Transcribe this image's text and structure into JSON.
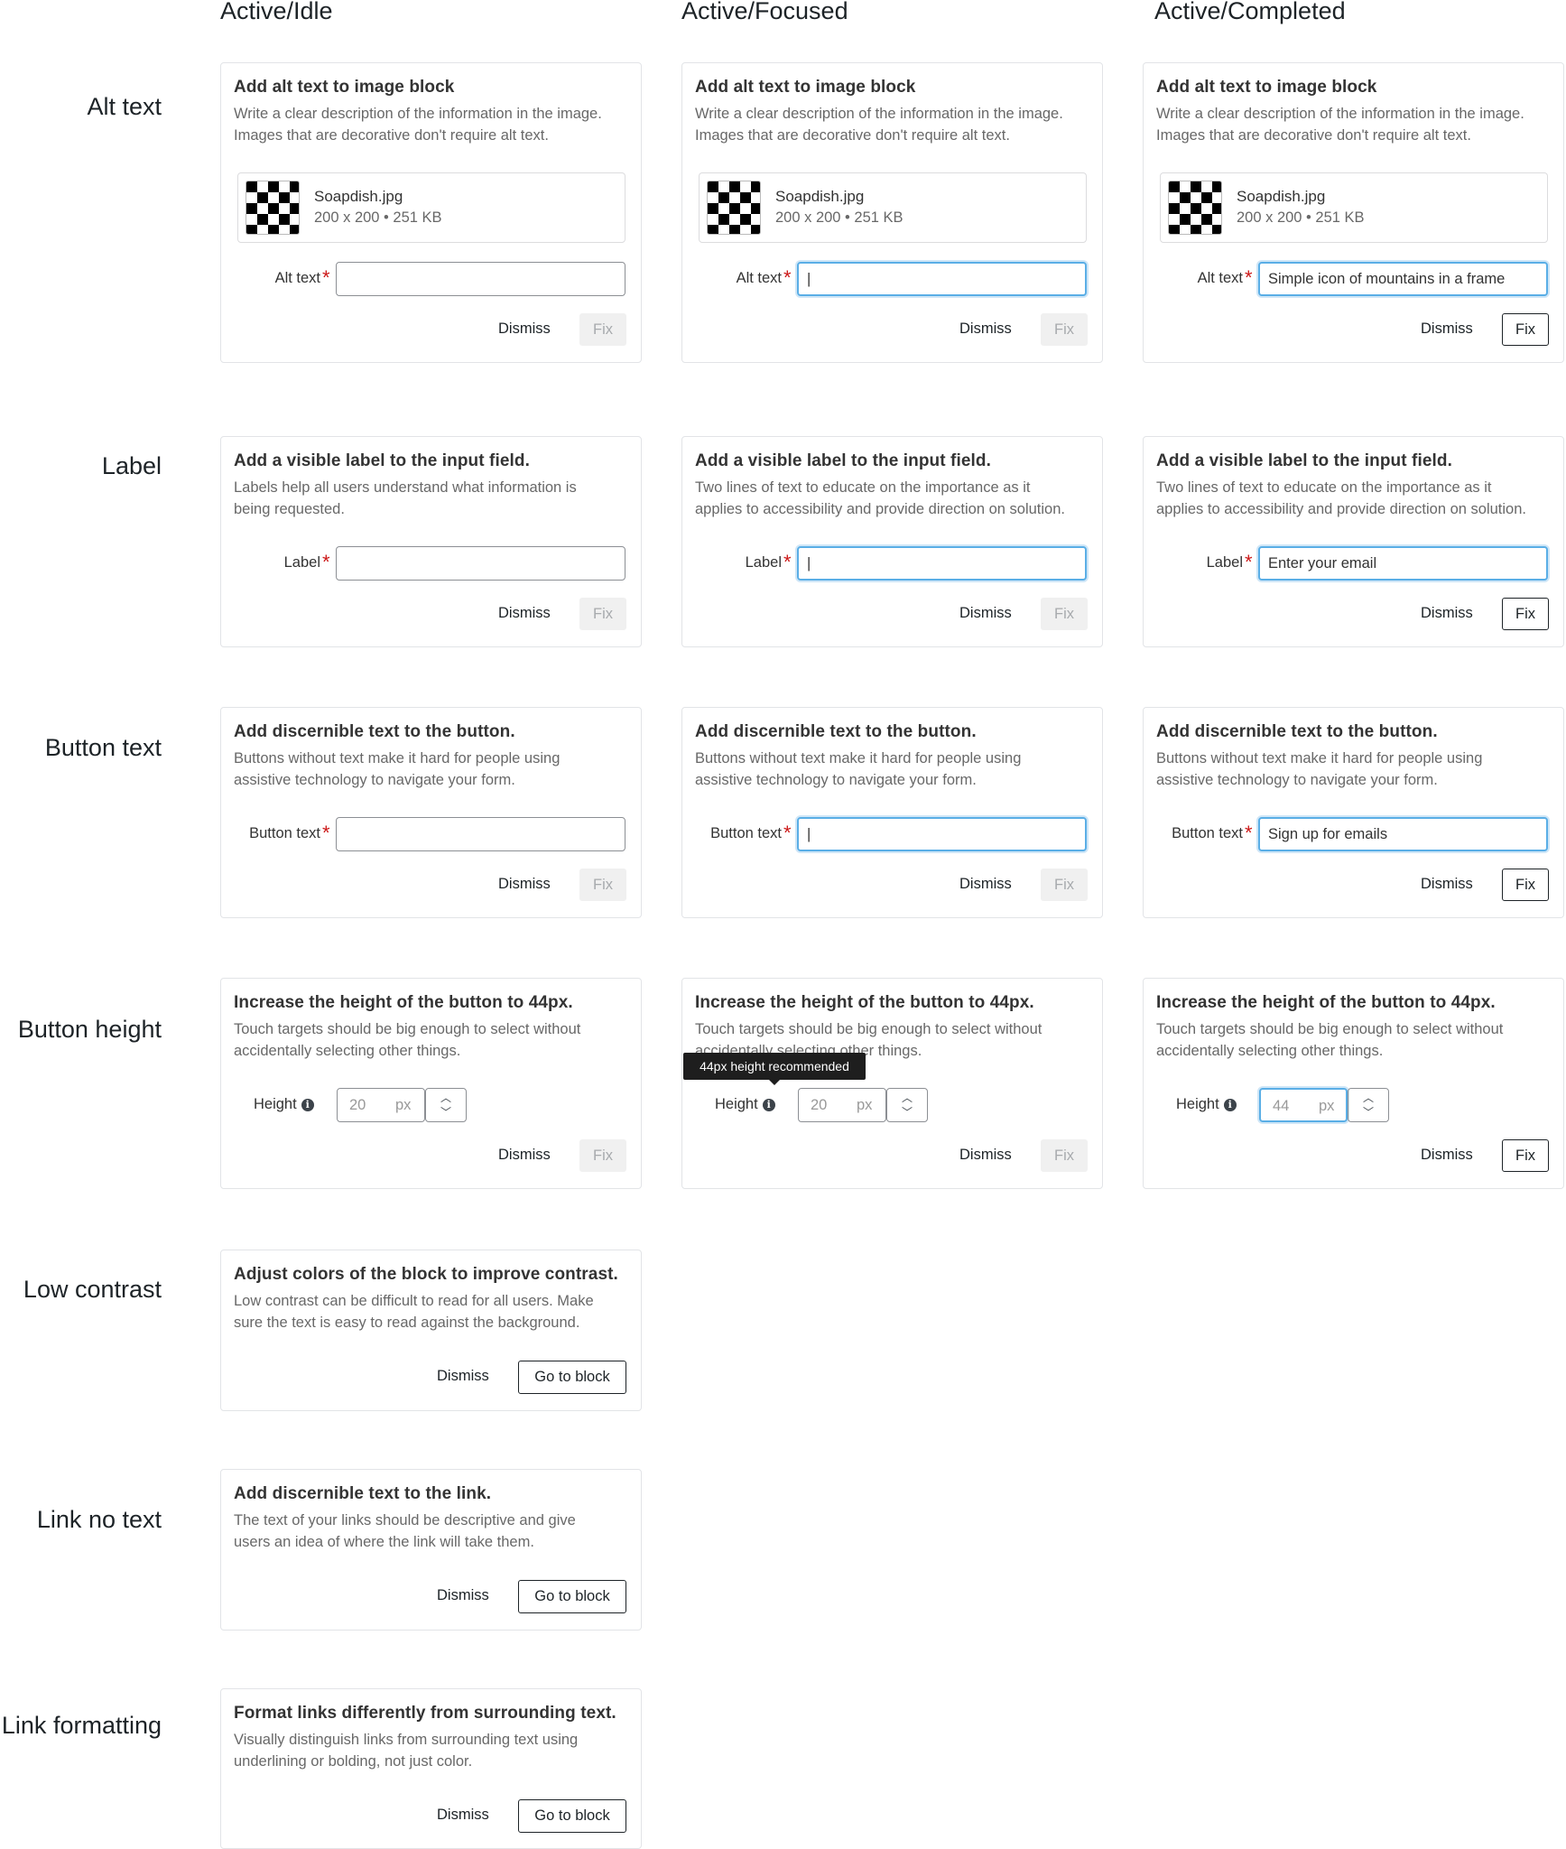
{
  "columns": {
    "idle": "Active/Idle",
    "focused": "Active/Focused",
    "completed": "Active/Completed"
  },
  "rows": {
    "alt_text": "Alt text",
    "label": "Label",
    "button_text": "Button text",
    "button_height": "Button height",
    "low_contrast": "Low contrast",
    "link_no_text": "Link no text",
    "link_formatting": "Link formatting"
  },
  "common": {
    "dismiss": "Dismiss",
    "fix": "Fix",
    "go_to_block": "Go to block",
    "caret": "|",
    "px": "px"
  },
  "alt_text": {
    "title": "Add alt text to image block",
    "desc_line1": "Write a clear description of the information in the image.",
    "desc_line2": "Images that are decorative don't require alt text.",
    "file_name": "Soapdish.jpg",
    "file_meta": "200 x 200 • 251 KB",
    "field_label": "Alt text",
    "completed_value": "Simple icon of mountains in a frame"
  },
  "label": {
    "title": "Add a visible label to the input field.",
    "idle_desc_line1": "Labels help all users understand what information is",
    "idle_desc_line2": "being requested.",
    "alt_desc_line1": "Two lines of text to educate on the importance as it",
    "alt_desc_line2": "applies to accessibility and provide direction on solution.",
    "field_label": "Label",
    "completed_value": "Enter your email"
  },
  "button_text": {
    "title": "Add discernible text to the button.",
    "desc_line1": "Buttons without text make it hard for people using",
    "desc_line2": "assistive technology to navigate your form.",
    "field_label": "Button text",
    "completed_value": "Sign up for emails"
  },
  "button_height": {
    "title": "Increase the height of the button to 44px.",
    "desc_line1": "Touch targets should be big enough to select without",
    "desc_line2": "accidentally selecting other things.",
    "field_label": "Height",
    "info_icon": "i",
    "idle_value": "20",
    "focused_value": "20",
    "completed_value": "44",
    "tooltip": "44px height recommended"
  },
  "low_contrast": {
    "title": "Adjust colors of the block to improve contrast.",
    "desc_line1": "Low contrast can be difficult to read for all users. Make",
    "desc_line2": "sure the text is easy to read against the background."
  },
  "link_no_text": {
    "title": "Add discernible text to the link.",
    "desc_line1": "The text of your links should be descriptive and give",
    "desc_line2": "users an idea of where the link will take them."
  },
  "link_formatting": {
    "title": "Format links differently from surrounding text.",
    "desc_line1": "Visually distinguish links from surrounding text using",
    "desc_line2": "underlining or bolding, not just color."
  },
  "icons": {
    "required": "*",
    "stepper_up": "chevron-up-icon",
    "stepper_down": "chevron-down-icon",
    "info": "info-icon"
  },
  "colors": {
    "focus_border": "#5aaee6",
    "required": "#cc1818",
    "disabled_button_bg": "#f0f0f0"
  }
}
